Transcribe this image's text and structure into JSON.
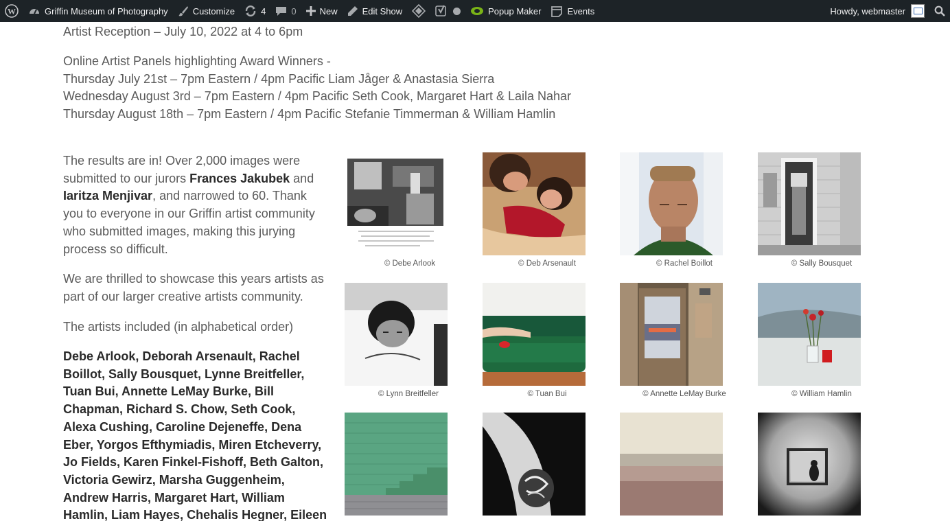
{
  "admin_bar": {
    "site_name": "Griffin Museum of Photography",
    "customize": "Customize",
    "updates_count": "4",
    "comments_count": "0",
    "new": "New",
    "edit_show": "Edit Show",
    "popup_maker": "Popup Maker",
    "events": "Events",
    "howdy": "Howdy, webmaster"
  },
  "content": {
    "reception": "Artist Reception – July 10, 2022 at 4 to 6pm",
    "panels_heading": "Online Artist Panels highlighting Award Winners -",
    "panels": [
      "Thursday July 21st – 7pm Eastern / 4pm Pacific Liam Jåger & Anastasia Sierra",
      "Wednesday August 3rd – 7pm Eastern / 4pm Pacific Seth Cook, Margaret Hart & Laila Nahar",
      "Thursday August 18th – 7pm Eastern / 4pm Pacific Stefanie Timmerman & William Hamlin"
    ],
    "intro_1": "The results are in! Over 2,000 images were submitted to our jurors ",
    "juror_1": "Frances Jakubek",
    "intro_2": " and ",
    "juror_2": "Iaritza Menjivar",
    "intro_3": ", and narrowed to 60. Thank you to everyone in our Griffin artist community who submitted images, making this jurying process so difficult.",
    "thrilled": "We are thrilled to showcase this years artists as part of our larger creative artists community.",
    "included": "The artists included (in alphabetical order)",
    "artists": "Debe Arlook, Deborah Arsenault, Rachel Boillot, Sally Bousquet, Lynne Breitfeller, Tuan Bui, Annette LeMay Burke, Bill Chapman, Richard S. Chow, Seth Cook, Alexa Cushing, Caroline Dejeneffe, Dena Eber, Yorgos Efthymiadis, Miren Etcheverry, Jo Fields, Karen Finkel-Fishoff, Beth Galton, Victoria Gewirz, Marsha Guggenheim, Andrew Harris, Margaret Hart, William Hamlin, Liam Hayes, Chehalis Hegner, Eileen Homuth Lemonick, Nanci Kahn, Nancy"
  },
  "gallery": [
    {
      "caption": "© Debe Arlook",
      "style": "bw-kitchen"
    },
    {
      "caption": "© Deb Arsenault",
      "style": "couple"
    },
    {
      "caption": "© Rachel Boillot",
      "style": "portrait"
    },
    {
      "caption": "© Sally Bousquet",
      "style": "bw-door"
    },
    {
      "caption": "© Lynn Breitfeller",
      "style": "bw-child"
    },
    {
      "caption": "© Tuan Bui",
      "style": "green-couch"
    },
    {
      "caption": "© Annette LeMay Burke",
      "style": "doorway"
    },
    {
      "caption": "© William Hamlin",
      "style": "flowers"
    },
    {
      "caption": "",
      "style": "green-stairs"
    },
    {
      "caption": "",
      "style": "tattoo"
    },
    {
      "caption": "",
      "style": "haze"
    },
    {
      "caption": "",
      "style": "mirror"
    }
  ]
}
